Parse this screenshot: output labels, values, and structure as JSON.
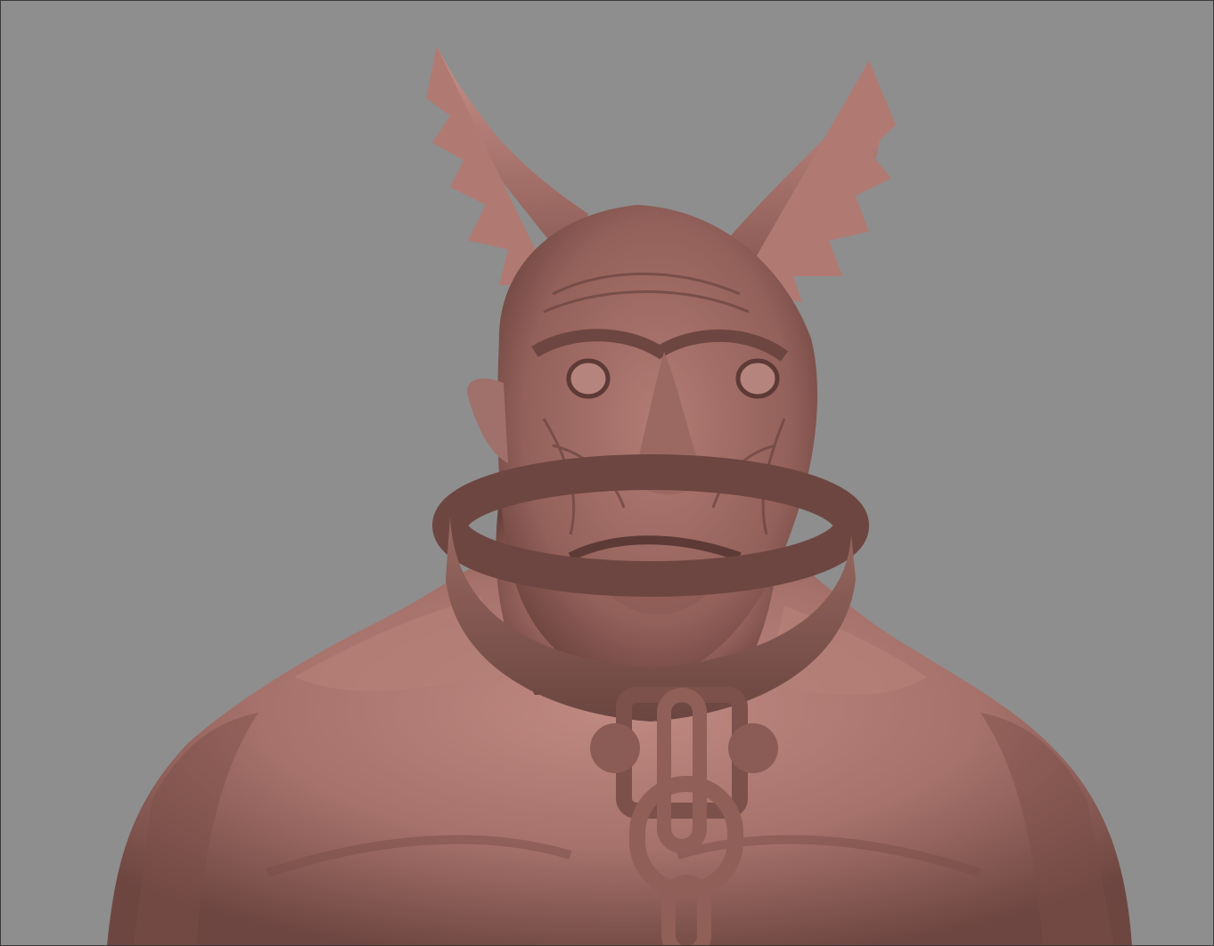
{
  "viewport": {
    "background_color": "#8e8e8e",
    "border_color": "#3a3a3a"
  },
  "model": {
    "subject": "horned-creature-bust",
    "material_color": "#a9726a",
    "material_shadow": "#6e4641",
    "material_highlight": "#c89088",
    "collar_color": "#8a5c55",
    "chain_color": "#8f5f58"
  }
}
